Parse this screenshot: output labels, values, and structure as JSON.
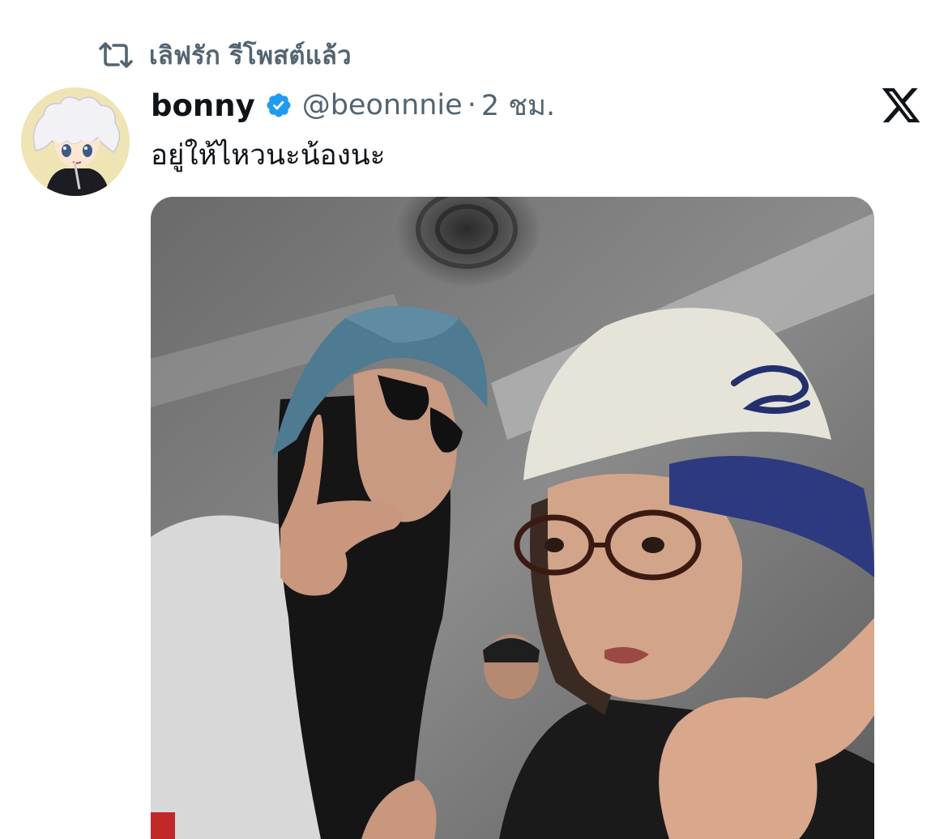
{
  "repost": {
    "icon": "repost-icon",
    "text": "เลิฟรัก รีโพสต์แล้ว"
  },
  "author": {
    "display_name": "bonny",
    "verified_icon": "verified-badge-icon",
    "handle": "@beonnnie",
    "separator": "·",
    "time": "2 ชม."
  },
  "tweet": {
    "text": "อยู่ให้ไหวนะน้องนะ"
  },
  "platform_logo": "x-logo-icon",
  "colors": {
    "secondary_text": "#536471",
    "primary_text": "#0f1419",
    "verified_blue": "#1d9bf0"
  }
}
